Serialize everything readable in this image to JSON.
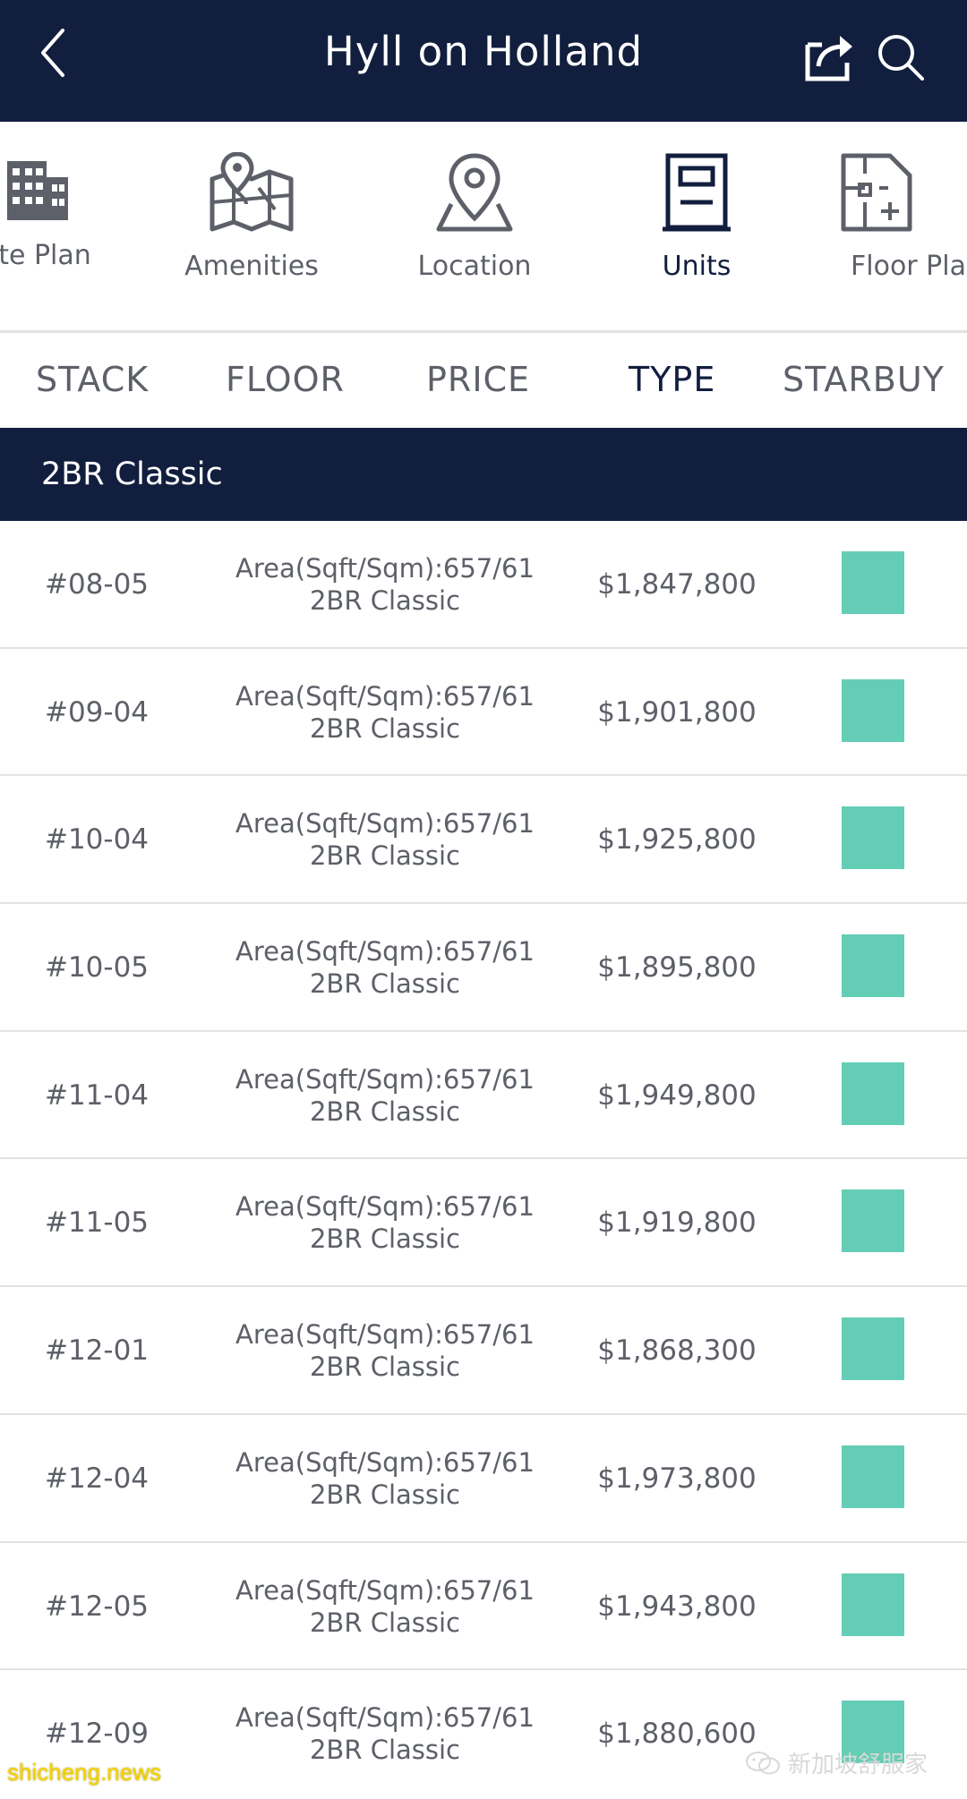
{
  "header": {
    "title": "Hyll on Holland",
    "back_icon": "chevron-left-icon",
    "share_icon": "share-icon",
    "search_icon": "search-icon"
  },
  "nav": {
    "items": [
      {
        "label": "te Plan",
        "icon": "building-icon"
      },
      {
        "label": "Amenities",
        "icon": "map-pin-icon"
      },
      {
        "label": "Location",
        "icon": "location-pin-icon"
      },
      {
        "label": "Units",
        "icon": "door-icon",
        "active": true
      },
      {
        "label": "Floor Pla",
        "icon": "floor-plan-icon"
      }
    ]
  },
  "tabs": {
    "items": [
      "STACK",
      "FLOOR",
      "PRICE",
      "TYPE",
      "STARBUY"
    ],
    "active": "TYPE"
  },
  "group": {
    "title": "2BR Classic"
  },
  "rows": [
    {
      "stack": "#08-05",
      "area": "Area(Sqft/Sqm):657/61",
      "type": "2BR Classic",
      "price": "$1,847,800"
    },
    {
      "stack": "#09-04",
      "area": "Area(Sqft/Sqm):657/61",
      "type": "2BR Classic",
      "price": "$1,901,800"
    },
    {
      "stack": "#10-04",
      "area": "Area(Sqft/Sqm):657/61",
      "type": "2BR Classic",
      "price": "$1,925,800"
    },
    {
      "stack": "#10-05",
      "area": "Area(Sqft/Sqm):657/61",
      "type": "2BR Classic",
      "price": "$1,895,800"
    },
    {
      "stack": "#11-04",
      "area": "Area(Sqft/Sqm):657/61",
      "type": "2BR Classic",
      "price": "$1,949,800"
    },
    {
      "stack": "#11-05",
      "area": "Area(Sqft/Sqm):657/61",
      "type": "2BR Classic",
      "price": "$1,919,800"
    },
    {
      "stack": "#12-01",
      "area": "Area(Sqft/Sqm):657/61",
      "type": "2BR Classic",
      "price": "$1,868,300"
    },
    {
      "stack": "#12-04",
      "area": "Area(Sqft/Sqm):657/61",
      "type": "2BR Classic",
      "price": "$1,973,800"
    },
    {
      "stack": "#12-05",
      "area": "Area(Sqft/Sqm):657/61",
      "type": "2BR Classic",
      "price": "$1,943,800"
    },
    {
      "stack": "#12-09",
      "area": "Area(Sqft/Sqm):657/61",
      "type": "2BR Classic",
      "price": "$1,880,600"
    }
  ],
  "colors": {
    "header_bg": "#121e3e",
    "starbuy": "#64cdb5"
  },
  "watermark": {
    "left": "shicheng.news",
    "right": "新加坡舒服家"
  }
}
